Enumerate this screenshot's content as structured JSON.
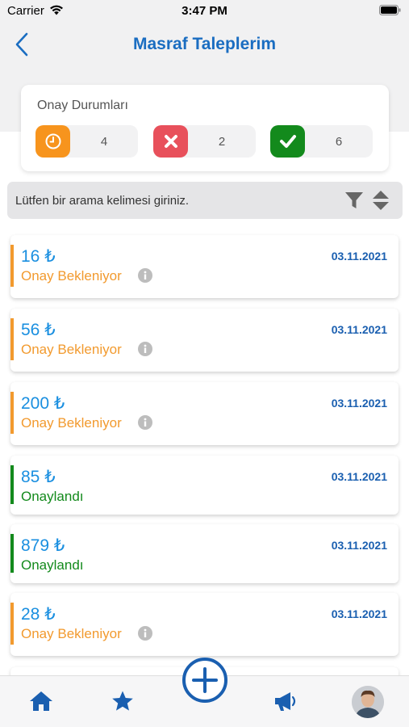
{
  "status_bar": {
    "carrier": "Carrier",
    "time": "3:47 PM"
  },
  "nav": {
    "title": "Masraf Taleplerim",
    "back_icon": "chevron-left-icon"
  },
  "approval": {
    "title": "Onay Durumları",
    "pending": {
      "icon": "clock-icon",
      "count": "4",
      "color": "#f7941d"
    },
    "rejected": {
      "icon": "x-icon",
      "count": "2",
      "color": "#e8505b"
    },
    "approved": {
      "icon": "check-icon",
      "count": "6",
      "color": "#138a1c"
    }
  },
  "search": {
    "placeholder": "Lütfen bir arama kelimesi giriniz."
  },
  "requests": [
    {
      "amount": "16 ₺",
      "status": "Onay Bekleniyor",
      "date": "03.11.2021",
      "state": "pending"
    },
    {
      "amount": "56 ₺",
      "status": "Onay Bekleniyor",
      "date": "03.11.2021",
      "state": "pending"
    },
    {
      "amount": "200 ₺",
      "status": "Onay Bekleniyor",
      "date": "03.11.2021",
      "state": "pending"
    },
    {
      "amount": "85 ₺",
      "status": "Onaylandı",
      "date": "03.11.2021",
      "state": "approved"
    },
    {
      "amount": "879 ₺",
      "status": "Onaylandı",
      "date": "03.11.2021",
      "state": "approved"
    },
    {
      "amount": "28 ₺",
      "status": "Onay Bekleniyor",
      "date": "03.11.2021",
      "state": "pending"
    }
  ],
  "colors": {
    "pending": "#f29a2e",
    "approved": "#138a1c",
    "accent": "#1a6dc1"
  },
  "tab_bar": [
    "home-icon",
    "star-icon",
    "add-icon",
    "megaphone-icon",
    "avatar"
  ]
}
